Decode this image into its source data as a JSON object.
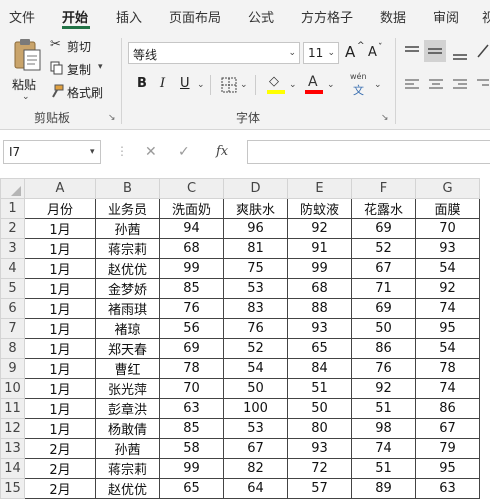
{
  "menu": {
    "tabs": [
      "文件",
      "开始",
      "插入",
      "页面布局",
      "公式",
      "方方格子",
      "数据",
      "审阅",
      "视"
    ],
    "active_index": 1
  },
  "ribbon": {
    "clipboard": {
      "paste_label": "粘贴",
      "cut_label": "剪切",
      "copy_label": "复制",
      "format_painter_label": "格式刷",
      "group_label": "剪贴板"
    },
    "font": {
      "font_name": "等线",
      "font_size": "11",
      "bold": "B",
      "italic": "I",
      "underline": "U",
      "grow": "A",
      "shrink": "A",
      "fill_color": "#ffff00",
      "font_color": "#ff0000",
      "phonetic_top": "wén",
      "phonetic_bottom": "文",
      "group_label": "字体"
    }
  },
  "formula_bar": {
    "name_box": "I7",
    "fx": "fx",
    "formula": ""
  },
  "sheet": {
    "columns": [
      "A",
      "B",
      "C",
      "D",
      "E",
      "F",
      "G"
    ],
    "row_numbers": [
      "1",
      "2",
      "3",
      "4",
      "5",
      "6",
      "7",
      "8",
      "9",
      "10",
      "11",
      "12",
      "13",
      "14",
      "15"
    ],
    "rows": [
      [
        "月份",
        "业务员",
        "洗面奶",
        "爽肤水",
        "防蚊液",
        "花露水",
        "面膜"
      ],
      [
        "1月",
        "孙茜",
        "94",
        "96",
        "92",
        "69",
        "70"
      ],
      [
        "1月",
        "蒋宗莉",
        "68",
        "81",
        "91",
        "52",
        "93"
      ],
      [
        "1月",
        "赵优优",
        "99",
        "75",
        "99",
        "67",
        "54"
      ],
      [
        "1月",
        "金梦娇",
        "85",
        "53",
        "68",
        "71",
        "92"
      ],
      [
        "1月",
        "褚雨琪",
        "76",
        "83",
        "88",
        "69",
        "74"
      ],
      [
        "1月",
        "褚琼",
        "56",
        "76",
        "93",
        "50",
        "95"
      ],
      [
        "1月",
        "郑天春",
        "69",
        "52",
        "65",
        "86",
        "54"
      ],
      [
        "1月",
        "曹红",
        "78",
        "54",
        "84",
        "76",
        "78"
      ],
      [
        "1月",
        "张光萍",
        "70",
        "50",
        "51",
        "92",
        "74"
      ],
      [
        "1月",
        "彭章洪",
        "63",
        "100",
        "50",
        "51",
        "86"
      ],
      [
        "1月",
        "杨敢倩",
        "85",
        "53",
        "80",
        "98",
        "67"
      ],
      [
        "2月",
        "孙茜",
        "58",
        "67",
        "93",
        "74",
        "79"
      ],
      [
        "2月",
        "蒋宗莉",
        "99",
        "82",
        "72",
        "51",
        "95"
      ],
      [
        "2月",
        "赵优优",
        "65",
        "64",
        "57",
        "89",
        "63"
      ]
    ]
  }
}
